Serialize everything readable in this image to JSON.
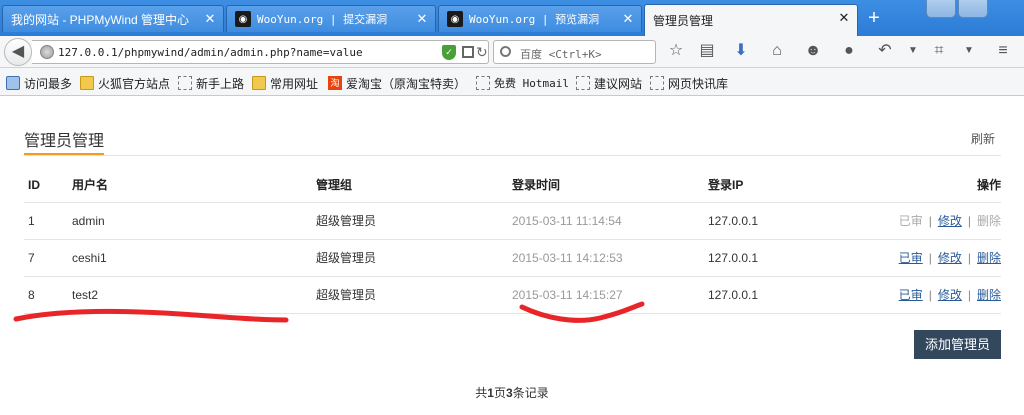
{
  "browser": {
    "tabs": [
      {
        "label": "我的网站 - PHPMyWind 管理中心",
        "active": false
      },
      {
        "label": "WooYun.org | 提交漏洞",
        "active": false
      },
      {
        "label": "WooYun.org | 预览漏洞",
        "active": false
      },
      {
        "label": "管理员管理",
        "active": true
      }
    ],
    "url": "127.0.0.1/phpmywind/admin/admin.php?name=value",
    "search_placeholder": "百度 <Ctrl+K>",
    "bookmarks": [
      "访问最多",
      "火狐官方站点",
      "新手上路",
      "常用网址",
      "爱淘宝（原淘宝特卖）",
      "免费 Hotmail",
      "建议网站",
      "网页快讯库"
    ]
  },
  "page": {
    "title": "管理员管理",
    "refresh_label": "刷新",
    "columns": [
      "ID",
      "用户名",
      "管理组",
      "登录时间",
      "登录IP",
      "操作"
    ],
    "rows": [
      {
        "id": "1",
        "username": "admin",
        "group": "超级管理员",
        "login_time": "2015-03-11 11:14:54",
        "login_ip": "127.0.0.1",
        "status": "已审",
        "edit": "修改",
        "delete": "删除"
      },
      {
        "id": "7",
        "username": "ceshi1",
        "group": "超级管理员",
        "login_time": "2015-03-11 14:12:53",
        "login_ip": "127.0.0.1",
        "status": "已审",
        "edit": "修改",
        "delete": "删除"
      },
      {
        "id": "8",
        "username": "test2",
        "group": "超级管理员",
        "login_time": "2015-03-11 14:15:27",
        "login_ip": "127.0.0.1",
        "status": "已审",
        "edit": "修改",
        "delete": "删除"
      }
    ],
    "add_button": "添加管理员",
    "pager": {
      "prefix": "共",
      "pages": "1",
      "mid": "页",
      "records": "3",
      "suffix": "条记录"
    }
  },
  "colors": {
    "accent_underline": "#f39c1e",
    "primary_button": "#33485c",
    "annotation_red": "#e8262a"
  }
}
